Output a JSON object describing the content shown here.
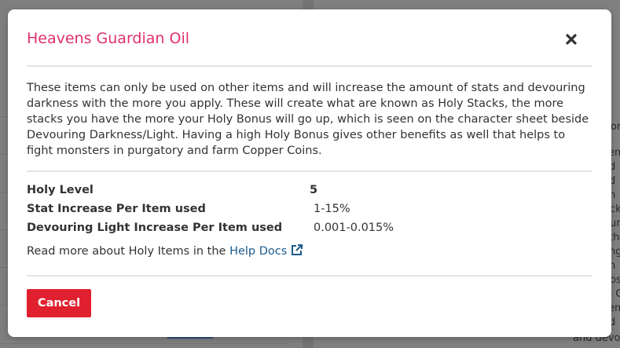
{
  "background": {
    "right_fragments": [
      "on",
      "em",
      "d",
      "d",
      "n",
      "e",
      "ck",
      "ur",
      "th",
      "ng",
      "n",
      "n",
      "os",
      "n C",
      "em",
      "d",
      "and devou"
    ]
  },
  "modal": {
    "title": "Heavens Guardian Oil",
    "title_color": "#e1306c",
    "close_icon": "close-icon",
    "description": "These items can only be used on other items and will increase the amount of stats and devouring darkness with the more you apply. These will create what are known as Holy Stacks, the more stacks you have the more your Holy Bonus will go up, which is seen on the character sheet beside Devouring Darkness/Light. Having a high Holy Bonus gives other benefits as well that helps to fight monsters in purgatory and farm Copper Coins.",
    "stats": [
      {
        "label": "Holy Level",
        "value": "5"
      },
      {
        "label": "Stat Increase Per Item used",
        "value": "1-15%"
      },
      {
        "label": "Devouring Light Increase Per Item used",
        "value": "0.001-0.015%"
      }
    ],
    "help_prefix": "Read more about Holy Items in the",
    "help_link": "Help Docs",
    "help_icon": "external-link-icon",
    "cancel_label": "Cancel",
    "cancel_color": "#e0202e",
    "link_color": "#1c5a8a"
  }
}
